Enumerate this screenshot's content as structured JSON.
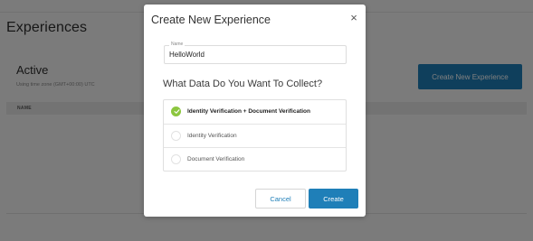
{
  "page": {
    "title": "Experiences",
    "section_title": "Active",
    "timezone_text": "Using time zone (GMT+00:00) UTC",
    "create_button_label": "Create New Experience",
    "table_header_name": "NAME"
  },
  "modal": {
    "title": "Create New Experience",
    "close_icon": "×",
    "name_label": "Name",
    "name_value": "HelloWorld",
    "question": "What Data Do You Want To Collect?",
    "options": [
      {
        "label": "Identity Verification + Document Verification",
        "selected": true
      },
      {
        "label": "Identity Verification",
        "selected": false
      },
      {
        "label": "Document Verification",
        "selected": false
      }
    ],
    "cancel_label": "Cancel",
    "create_label": "Create"
  },
  "colors": {
    "accent": "#1f7fb8",
    "selected_check": "#8cc63f",
    "overlay": "rgba(0,0,0,0.5)"
  },
  "icons": {
    "close": "close-icon",
    "selected": "check-icon"
  }
}
